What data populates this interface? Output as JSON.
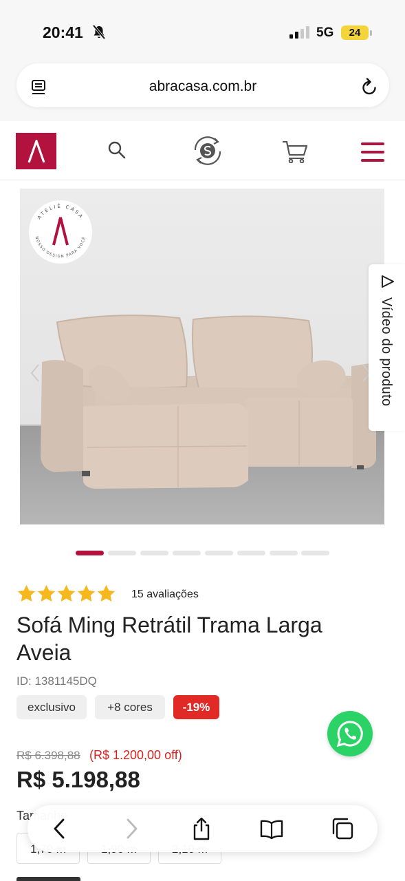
{
  "status_bar": {
    "time": "20:41",
    "network": "5G",
    "battery": "24"
  },
  "browser": {
    "url": "abracasa.com.br"
  },
  "site": {
    "brand_color": "#b3123f"
  },
  "gallery": {
    "seal_top_text": "ATELIÊ CASA",
    "seal_bottom_text": "NOSSO DESIGN PARA VOCÊ",
    "video_tab_label": "Vídeo do produto",
    "slide_count": 8,
    "active_slide": 1
  },
  "product": {
    "rating": 5,
    "reviews_label": "15 avaliações",
    "title": "Sofá Ming Retrátil Trama Larga Aveia",
    "id_label": "ID: 1381145DQ",
    "badges": [
      "exclusivo",
      "+8 cores",
      "-19%"
    ],
    "old_price": "R$ 6.398,88",
    "discount_text": "(R$ 1.200,00 off)",
    "price": "R$ 5.198,88",
    "size_label": "Tamanho",
    "sizes": [
      "1,70 m",
      "1,90 m",
      "2,10 m"
    ]
  },
  "colors": {
    "accent": "#b3123f",
    "sale": "#e12a26",
    "whatsapp": "#2bd366",
    "star": "#f6b81c"
  }
}
